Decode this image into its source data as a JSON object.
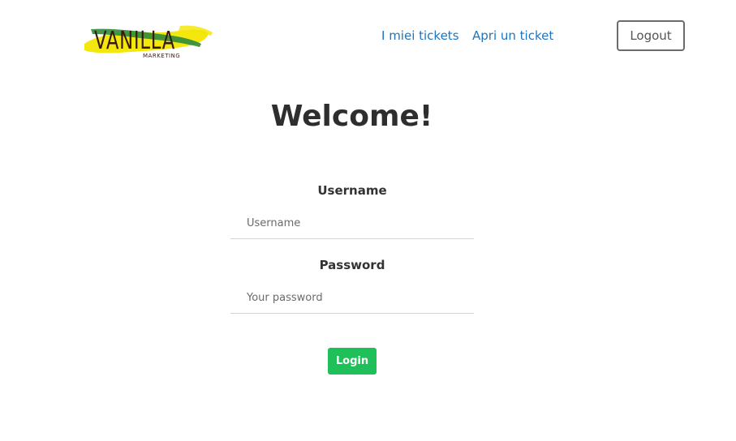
{
  "header": {
    "logo": {
      "text": "VANILLA",
      "subtext": "MARKETING",
      "colors": {
        "yellow": "#f2e600",
        "green": "#2e8b3a",
        "ink": "#3a1a10"
      }
    },
    "nav": [
      {
        "label": "I miei tickets"
      },
      {
        "label": "Apri un ticket"
      }
    ],
    "logout_label": "Logout"
  },
  "main": {
    "title": "Welcome!",
    "username": {
      "label": "Username",
      "placeholder": "Username",
      "value": ""
    },
    "password": {
      "label": "Password",
      "placeholder": "Your password",
      "value": ""
    },
    "login_label": "Login"
  },
  "colors": {
    "link": "#1f74bf",
    "accent_green": "#1fbf5a",
    "border_gray": "#6c6c6c"
  }
}
